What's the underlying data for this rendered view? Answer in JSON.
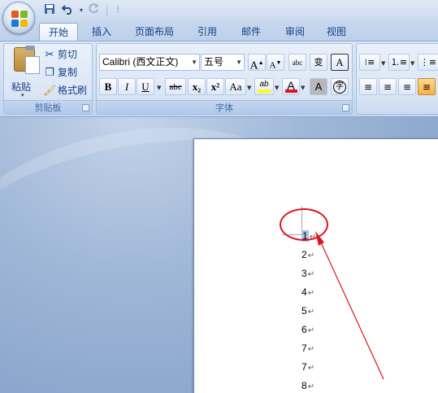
{
  "tabs": [
    "开始",
    "插入",
    "页面布局",
    "引用",
    "邮件",
    "审阅",
    "视图"
  ],
  "clipboard": {
    "paste_label": "粘贴",
    "cut_label": "剪切",
    "copy_label": "复制",
    "format_painter_label": "格式刷",
    "group_label": "剪贴板"
  },
  "font": {
    "font_name": "Calibri (西文正文)",
    "font_size": "五号",
    "group_label": "字体",
    "bold": "B",
    "italic": "I",
    "underline": "U",
    "strikethrough": "abc",
    "subscript": "x₂",
    "superscript": "x²",
    "change_case": "Aa",
    "grow_font": "A",
    "shrink_font": "A",
    "phonetic": "变",
    "border": "A",
    "shading": "A",
    "enclose": "字",
    "highlight": "ab",
    "font_color": "A",
    "clear_format": "abc"
  },
  "document": {
    "lines": [
      "1",
      "2",
      "3",
      "4",
      "5",
      "6",
      "7",
      "7",
      "8"
    ],
    "paragraph_mark": "↵"
  },
  "colors": {
    "annotation": "#e0141e",
    "ribbon_text": "#15428b",
    "highlight_yellow": "#ffff00",
    "font_red": "#e0141e"
  }
}
